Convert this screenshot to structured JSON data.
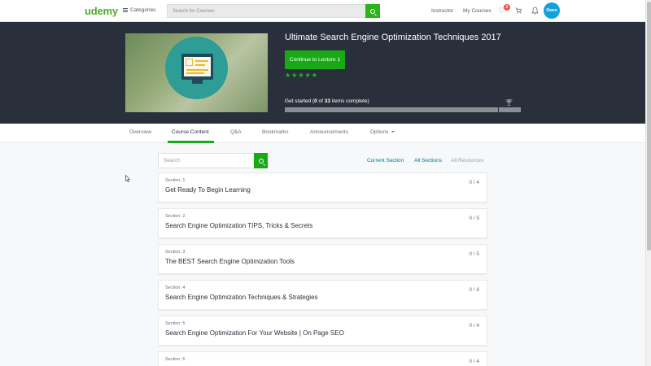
{
  "nav": {
    "logo": "udemy",
    "categories": "Categories",
    "search_placeholder": "Search for Courses",
    "instructor": "Instructor",
    "my_courses": "My Courses",
    "wishlist_badge": "2",
    "avatar_text": "Owen"
  },
  "course": {
    "title": "Ultimate Search Engine Optimization Techniques 2017",
    "continue_label": "Continue to Lecture 1",
    "stars": [
      "★",
      "★",
      "★",
      "★",
      "★"
    ],
    "progress_prefix": "Get started (",
    "completed": "0",
    "progress_of": " of ",
    "total": "33",
    "progress_suffix": " items complete)",
    "progress_fraction": 0.0
  },
  "tabs": [
    {
      "label": "Overview"
    },
    {
      "label": "Course Content"
    },
    {
      "label": "Q&A"
    },
    {
      "label": "Bookmarks"
    },
    {
      "label": "Announcements"
    },
    {
      "label": "Options"
    }
  ],
  "content": {
    "search_placeholder": "Search",
    "filters": [
      "Current Section",
      "All Sections",
      "All Resources"
    ]
  },
  "sections": [
    {
      "num": "Section: 1",
      "title": "Get Ready To Begin Learning",
      "count": "0 / 4"
    },
    {
      "num": "Section: 2",
      "title": "Search Engine Optimization TIPS, Tricks & Secrets",
      "count": "0 / 5"
    },
    {
      "num": "Section: 3",
      "title": "The BEST Search Engine Optimization Tools",
      "count": "0 / 5"
    },
    {
      "num": "Section: 4",
      "title": "Search Engine Optimization Techniques & Strategies",
      "count": "0 / 8"
    },
    {
      "num": "Section: 5",
      "title": "Search Engine Optimization For Your Website | On Page SEO",
      "count": "0 / 4"
    },
    {
      "num": "Section: 6",
      "title": "",
      "count": "0 / 4"
    }
  ],
  "colors": {
    "brand_green": "#1aa916",
    "header_dark": "#29303b",
    "link_teal": "#007791",
    "badge_red": "#ec5252",
    "avatar_blue": "#14a0d8"
  }
}
